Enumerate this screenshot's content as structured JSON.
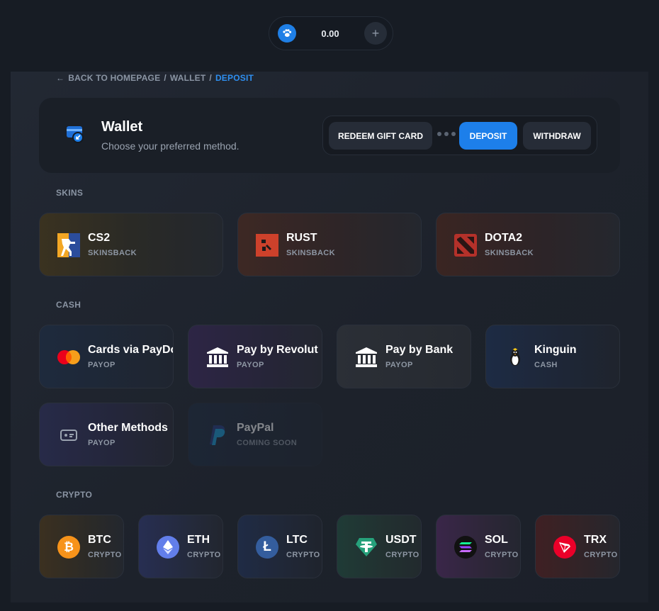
{
  "balance": {
    "amount": "0.00",
    "add_label": "+"
  },
  "breadcrumb": {
    "back": "BACK TO HOMEPAGE",
    "sep1": "/",
    "wallet": "WALLET",
    "sep2": "/",
    "current": "DEPOSIT"
  },
  "wallet": {
    "title": "Wallet",
    "subtitle": "Choose your preferred method.",
    "tabs": {
      "redeem": "REDEEM GIFT CARD",
      "deposit": "DEPOSIT",
      "withdraw": "WITHDRAW"
    }
  },
  "sections": {
    "skins": "SKINS",
    "cash": "CASH",
    "crypto": "CRYPTO"
  },
  "skins": [
    {
      "name": "CS2",
      "provider": "SKINSBACK"
    },
    {
      "name": "RUST",
      "provider": "SKINSBACK"
    },
    {
      "name": "DOTA2",
      "provider": "SKINSBACK"
    }
  ],
  "cash": [
    {
      "name": "Cards via PayDo",
      "provider": "PAYOP"
    },
    {
      "name": "Pay by Revolut",
      "provider": "PAYOP"
    },
    {
      "name": "Pay by Bank",
      "provider": "PAYOP"
    },
    {
      "name": "Kinguin",
      "provider": "CASH"
    },
    {
      "name": "Other Methods",
      "provider": "PAYOP"
    },
    {
      "name": "PayPal",
      "provider": "COMING SOON"
    }
  ],
  "crypto": [
    {
      "name": "BTC",
      "provider": "CRYPTO"
    },
    {
      "name": "ETH",
      "provider": "CRYPTO"
    },
    {
      "name": "LTC",
      "provider": "CRYPTO"
    },
    {
      "name": "USDT",
      "provider": "CRYPTO"
    },
    {
      "name": "SOL",
      "provider": "CRYPTO"
    },
    {
      "name": "TRX",
      "provider": "CRYPTO"
    }
  ],
  "colors": {
    "accent": "#1d7fea",
    "background": "#171c24"
  }
}
